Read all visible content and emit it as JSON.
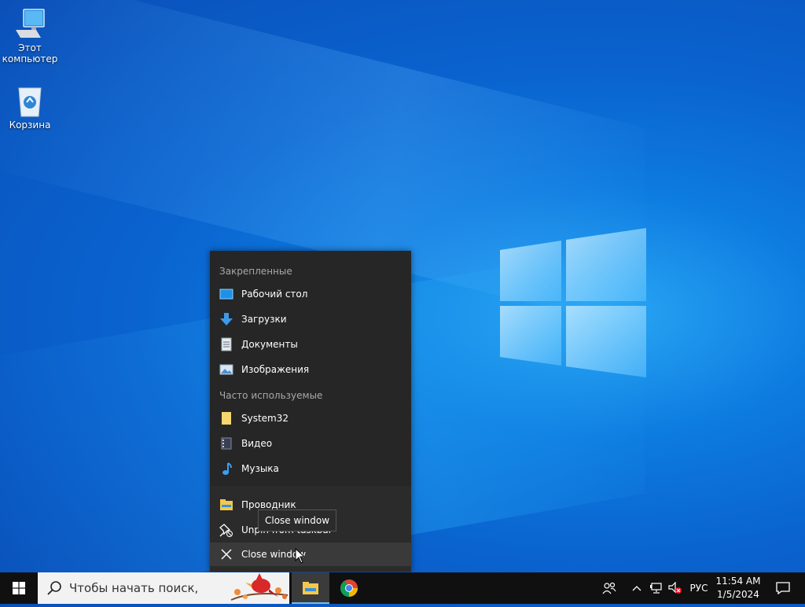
{
  "desktop": {
    "icons": [
      {
        "label_line1": "Этот",
        "label_line2": "компьютер",
        "icon": "computer-icon"
      },
      {
        "label_line1": "Корзина",
        "icon": "recycle-bin-icon"
      }
    ]
  },
  "jumplist": {
    "pinned_header": "Закрепленные",
    "pinned": [
      {
        "label": "Рабочий стол",
        "icon": "desktop-folder-icon"
      },
      {
        "label": "Загрузки",
        "icon": "downloads-icon"
      },
      {
        "label": "Документы",
        "icon": "documents-icon"
      },
      {
        "label": "Изображения",
        "icon": "pictures-icon"
      }
    ],
    "frequent_header": "Часто используемые",
    "frequent": [
      {
        "label": "System32",
        "icon": "folder-icon"
      },
      {
        "label": "Видео",
        "icon": "videos-icon"
      },
      {
        "label": "Музыка",
        "icon": "music-icon"
      }
    ],
    "tasks": [
      {
        "label": "Проводник",
        "icon": "file-explorer-icon"
      },
      {
        "label": "Unpin from taskbar",
        "icon": "unpin-icon"
      },
      {
        "label": "Close window",
        "icon": "close-icon"
      }
    ]
  },
  "tooltip": "Close window",
  "taskbar": {
    "search_placeholder": "Чтобы начать поиск,",
    "apps": [
      "file-explorer-icon",
      "chrome-icon"
    ],
    "language": "РУС",
    "time": "11:54 AM",
    "date": "1/5/2024"
  },
  "colors": {
    "accent": "#76b9ed",
    "jumplist_bg": "#2b2b2b",
    "taskbar_bg": "#101010"
  }
}
